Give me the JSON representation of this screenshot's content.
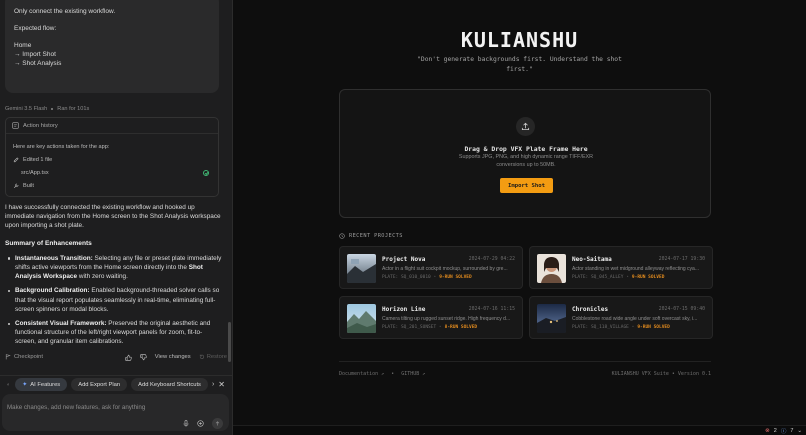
{
  "chat": {
    "user_bubble": {
      "lines": [
        "Only connect the existing workflow.",
        "",
        "Expected flow:",
        "",
        "Home",
        "→ Import Shot",
        "→ Shot Analysis"
      ]
    },
    "meta": {
      "model": "Gemini 3.5 Flash",
      "ran_for": "Ran for 101s"
    },
    "action_history": {
      "title": "Action history",
      "intro": "Here are key actions taken for the app:",
      "edited": "Edited 1 file",
      "file": "src/App.tsx",
      "built": "Built"
    },
    "response": {
      "intro": "I have successfully connected the existing workflow and hooked up immediate navigation from the Home screen to the Shot Analysis workspace upon importing a shot plate.",
      "summary_title": "Summary of Enhancements",
      "items": [
        {
          "title": "Instantaneous Transition:",
          "text_a": " Selecting any file or preset plate immediately shifts active viewports from the Home screen directly into the ",
          "bold": "Shot Analysis Workspace",
          "text_b": " with zero waiting."
        },
        {
          "title": "Background Calibration:",
          "text_a": " Enabled background-threaded solver calls so that the visual report populates seamlessly in real-time, eliminating full-screen spinners or modal blocks.",
          "bold": "",
          "text_b": ""
        },
        {
          "title": "Consistent Visual Framework:",
          "text_a": " Preserved the original aesthetic and functional structure of the left/right viewport panels for zoom, fit-to-screen, and granular item calibrations.",
          "bold": "",
          "text_b": ""
        }
      ]
    },
    "bottom_actions": {
      "checkpoint": "Checkpoint",
      "view_changes": "View changes",
      "restore": "Restore"
    },
    "chips": [
      "AI Features",
      "Add Export Plan",
      "Add Keyboard Shortcuts"
    ],
    "composer_placeholder": "Make changes, add new features, ask for anything"
  },
  "app": {
    "brand": "KULIANSHU",
    "tagline": "\"Don't generate backgrounds first. Understand the shot first.\"",
    "dropzone": {
      "title": "Drag & Drop VFX Plate Frame Here",
      "subtitle": "Supports JPG, PNG, and high dynamic range TIFF/EXR conversions up to 50MB.",
      "button": "Import Shot"
    },
    "recent_title": "RECENT PROJECTS",
    "projects": [
      {
        "name": "Project Nova",
        "date": "2024-07-29 04:22",
        "desc": "Actor in a flight suit cockpit mockup, surrounded by gre...",
        "plate": "PLATE: SQ_010_0010",
        "solver": "9-RUN SOLVED"
      },
      {
        "name": "Neo-Saitama",
        "date": "2024-07-17 19:30",
        "desc": "Actor standing in wet midground alleyway reflecting cya...",
        "plate": "PLATE: SQ_045_ALLEY",
        "solver": "9-RUN SOLVED"
      },
      {
        "name": "Horizon Line",
        "date": "2024-07-16 11:15",
        "desc": "Camera tilting up rugged sunset ridge. High frequency d...",
        "plate": "PLATE: SQ_201_SUNSET",
        "solver": "8-RUN SOLVED"
      },
      {
        "name": "Chronicles",
        "date": "2024-07-15 09:40",
        "desc": "Cobblestone road wide angle under soft overcast sky, i...",
        "plate": "PLATE: SQ_118_VILLAGE",
        "solver": "9-RUN SOLVED"
      }
    ],
    "footer": {
      "docs": "Documentation",
      "github": "GITHUB",
      "version": "KULIANSHU VFX Suite • Version 0.1"
    },
    "status": {
      "errors": "2",
      "warnings": "7"
    }
  },
  "colors": {
    "accent": "#f39c12",
    "success": "#3fb673",
    "bg": "#0e0e0e",
    "panel": "#1e1e1f"
  }
}
